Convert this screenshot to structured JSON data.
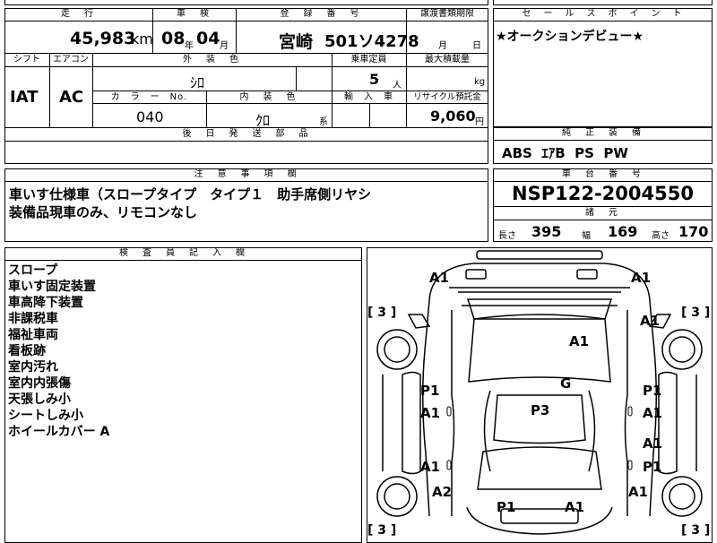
{
  "top_row": {
    "headers": {
      "mileage": "走　行",
      "inspection": "車　検",
      "registration": "登　録　番　号",
      "transfer_deadline": "譲渡書類期限"
    },
    "mileage_value": "45,983",
    "mileage_unit": "km",
    "inspection_year": "08",
    "inspection_year_unit": "年",
    "inspection_month": "04",
    "inspection_month_unit": "月",
    "registration_area": "宮崎",
    "registration_number": "501ソ4278",
    "transfer_month_unit": "月",
    "transfer_day_unit": "日"
  },
  "second_row": {
    "headers": {
      "shift": "シフト",
      "aircon": "エアコン",
      "exterior_color": "外　装　色",
      "capacity": "乗車定員",
      "max_load": "最大積載量",
      "color_no": "カ　ラ　ー　No.",
      "interior_color": "内　装　色",
      "import": "輸　入　車",
      "recycle": "リサイクル預託金"
    },
    "shift_value": "IAT",
    "aircon_value": "AC",
    "exterior_color_value": "ｼﾛ",
    "capacity_value": "5",
    "capacity_unit": "人",
    "max_load_unit": "kg",
    "color_no_value": "040",
    "interior_color_value": "ｸﾛ",
    "interior_color_suffix": "系",
    "recycle_value": "9,060",
    "recycle_unit": "円"
  },
  "later_parts": {
    "header": "後　日　発　送　部　品"
  },
  "sales_point": {
    "header": "セ　ー　ル　ス　ポ　イ　ン　ト",
    "text": "★オークションデビュー★"
  },
  "standard_equipment": {
    "header": "純　正　装　備",
    "text": "ABS  ｴｱB  PS  PW"
  },
  "notes": {
    "header": "注　意　事　項　欄",
    "line1": "車いす仕様車（スロープタイプ　タイプ１　助手席側リヤシ",
    "line2": "装備品現車のみ、リモコンなし"
  },
  "chassis": {
    "header": "車　台　番　号",
    "number": "NSP122-2004550",
    "dims_header": "諸　元",
    "length_label": "長さ",
    "length_value": "395",
    "width_label": "幅",
    "width_value": "169",
    "height_label": "高さ",
    "height_value": "170"
  },
  "inspector": {
    "header": "検　査　員　記　入　欄",
    "lines": [
      "スロープ",
      "車いす固定装置",
      "車高降下装置",
      "非課税車",
      "福祉車両",
      "看板跡",
      "室内汚れ",
      "室内内張傷",
      "天張しみ小",
      "シートしみ小",
      "ホイールカバー A"
    ]
  },
  "diagram": {
    "tire_marks": [
      "[ 3 ]",
      "[ 3 ]",
      "[ 3 ]",
      "[ 3 ]"
    ],
    "damage_labels": [
      "A1",
      "A1",
      "A1",
      "A1",
      "P1",
      "A1",
      "P1",
      "A1",
      "G",
      "P3",
      "A1",
      "A1",
      "P1",
      "A2",
      "A1",
      "P1",
      "A1"
    ]
  }
}
